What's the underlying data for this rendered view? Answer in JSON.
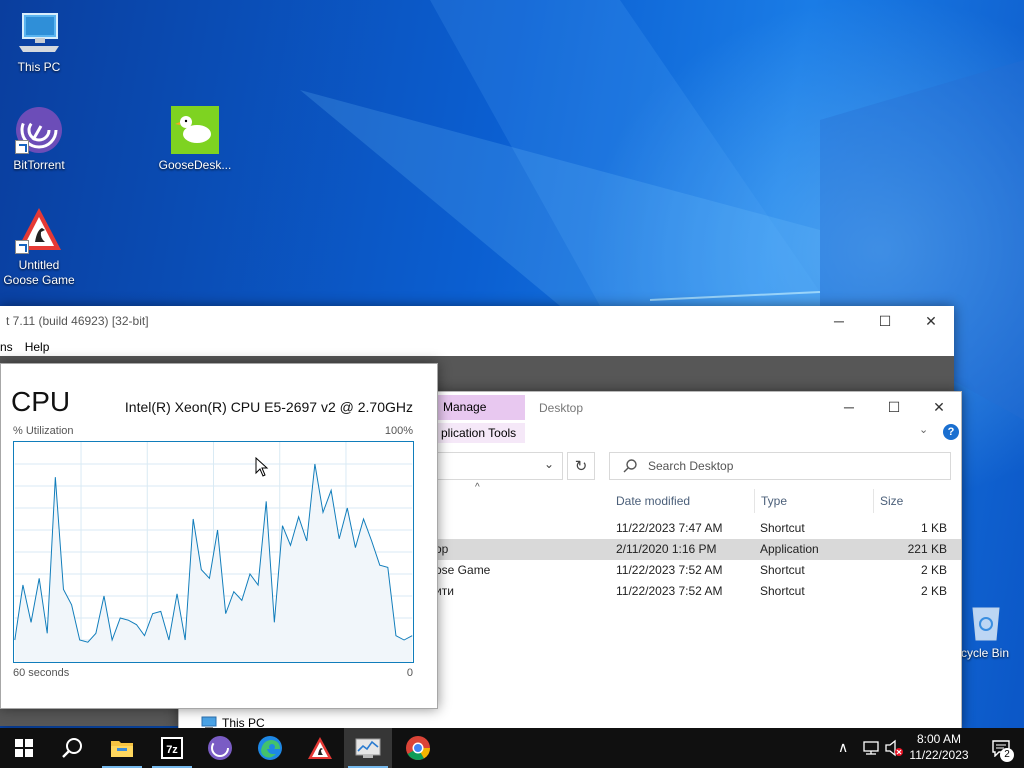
{
  "desktop": {
    "icons": [
      {
        "label": "This PC"
      },
      {
        "label": "BitTorrent"
      },
      {
        "label": "GooseDesk..."
      },
      {
        "label": "Untitled Goose Game"
      },
      {
        "label": "cycle Bin"
      }
    ]
  },
  "zip_window": {
    "title": "t 7.11  (build 46923) [32-bit]",
    "menu": [
      "ns",
      "Help"
    ]
  },
  "explorer": {
    "tab_manage": "Manage",
    "tab_desktop": "Desktop",
    "context_tab": "plication Tools",
    "search_placeholder": "Search Desktop",
    "columns": {
      "date": "Date modified",
      "type": "Type",
      "size": "Size"
    },
    "rows": [
      {
        "name": "",
        "date": "11/22/2023 7:47 AM",
        "type": "Shortcut",
        "size": "1 KB"
      },
      {
        "name": "op",
        "date": "2/11/2020 1:16 PM",
        "type": "Application",
        "size": "221 KB"
      },
      {
        "name": "ose Game",
        "date": "11/22/2023 7:52 AM",
        "type": "Shortcut",
        "size": "2 KB"
      },
      {
        "name": "ити",
        "date": "11/22/2023 7:52 AM",
        "type": "Shortcut",
        "size": "2 KB"
      }
    ],
    "nav_this_pc": "This PC"
  },
  "cpu": {
    "title": "CPU",
    "model": "Intel(R) Xeon(R) CPU E5-2697 v2 @ 2.70GHz",
    "util_label": "% Utilization",
    "util_max": "100%",
    "time_label": "60 seconds",
    "time_min": "0",
    "line_color": "#117dbb",
    "fill_color": "#f1f6fa",
    "history_percent": [
      10,
      35,
      18,
      38,
      13,
      84,
      33,
      26,
      10,
      9,
      13,
      30,
      10,
      20,
      19,
      17,
      12,
      22,
      23,
      10,
      31,
      10,
      65,
      42,
      38,
      60,
      22,
      32,
      28,
      40,
      35,
      73,
      18,
      62,
      53,
      66,
      55,
      90,
      68,
      78,
      56,
      70,
      52,
      65,
      55,
      44,
      43,
      12,
      10,
      12
    ]
  },
  "taskbar": {
    "apps": [
      "start",
      "search",
      "file-explorer",
      "7zip",
      "bittorrent",
      "edge",
      "goose-game",
      "task-manager",
      "chrome"
    ],
    "time": "8:00 AM",
    "date": "11/22/2023",
    "notifications": "2"
  },
  "colors": {
    "taskbar": "#101010",
    "accent": "#117dbb"
  }
}
